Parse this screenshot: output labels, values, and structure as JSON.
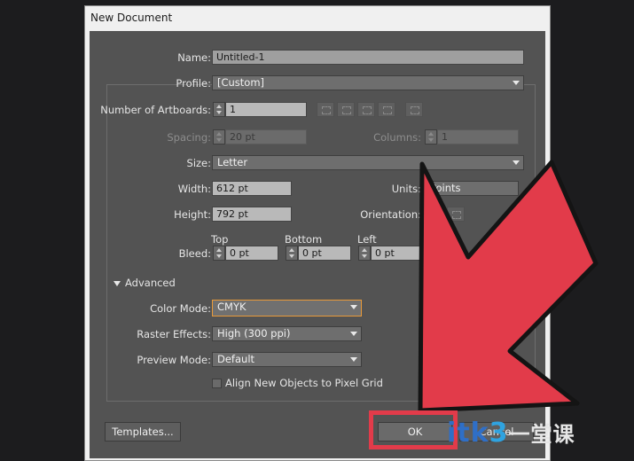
{
  "window": {
    "title": "New Document"
  },
  "form": {
    "name_label": "Name:",
    "name_value": "Untitled-1",
    "profile_label": "Profile:",
    "profile_value": "[Custom]",
    "artboards_label": "Number of Artboards:",
    "artboards_value": "1",
    "spacing_label": "Spacing:",
    "spacing_value": "20 pt",
    "columns_label": "Columns:",
    "columns_value": "1",
    "size_label": "Size:",
    "size_value": "Letter",
    "width_label": "Width:",
    "width_value": "612 pt",
    "units_label": "Units:",
    "units_value": "Points",
    "height_label": "Height:",
    "height_value": "792 pt",
    "orientation_label": "Orientation:",
    "bleed_label": "Bleed:",
    "bleed_top_label": "Top",
    "bleed_top_value": "0 pt",
    "bleed_bottom_label": "Bottom",
    "bleed_bottom_value": "0 pt",
    "bleed_left_label": "Left",
    "bleed_left_value": "0 pt"
  },
  "advanced": {
    "toggle_label": "Advanced",
    "color_mode_label": "Color Mode:",
    "color_mode_value": "CMYK",
    "raster_label": "Raster Effects:",
    "raster_value": "High (300 ppi)",
    "preview_label": "Preview Mode:",
    "preview_value": "Default",
    "align_label": "Align New Objects to Pixel Grid"
  },
  "buttons": {
    "templates": "Templates...",
    "ok": "OK",
    "cancel": "Cancel"
  },
  "watermark": {
    "part1": "itk",
    "part2": "3",
    "part3": "一堂课"
  },
  "colors": {
    "arrow": "#e23b4a",
    "dialog_bg": "#535353",
    "focus": "#e89a3a"
  }
}
